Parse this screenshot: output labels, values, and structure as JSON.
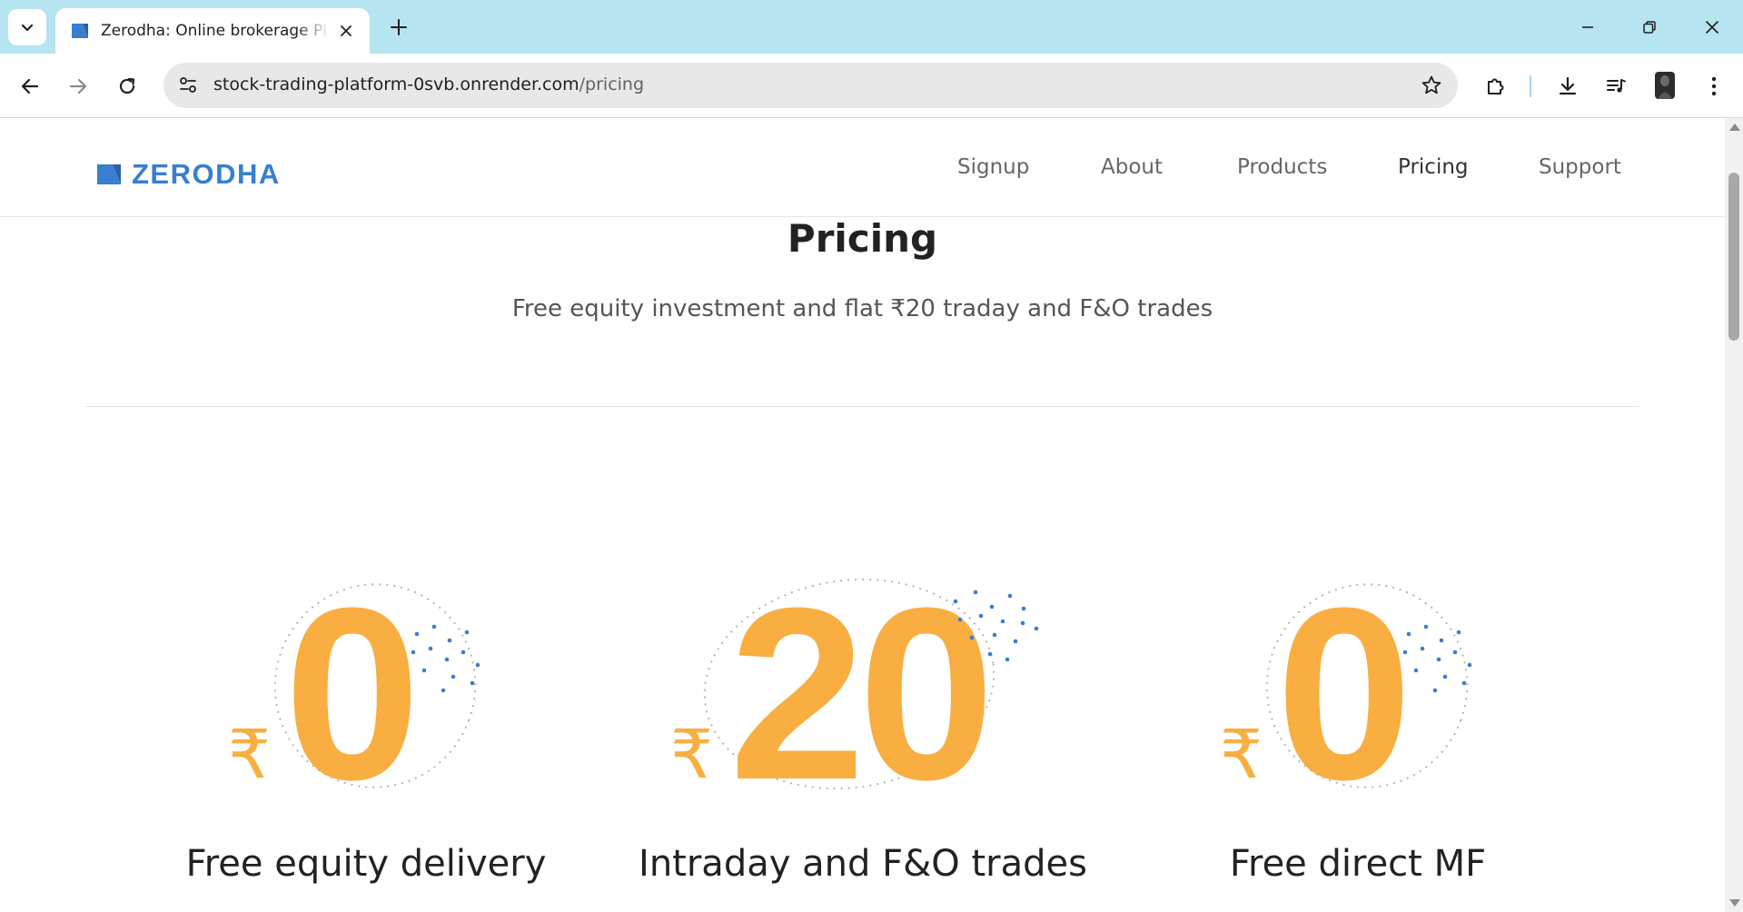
{
  "browser": {
    "tab_title": "Zerodha: Online brokerage Platform",
    "url_host": "stock-trading-platform-0svb.onrender.com",
    "url_path": "/pricing",
    "icons": {
      "tab_search": "chevron-down-icon",
      "tab_close": "close-icon",
      "new_tab": "plus-icon",
      "back": "arrow-left-icon",
      "forward": "arrow-right-icon",
      "reload": "reload-icon",
      "site_info": "tune-icon",
      "bookmark": "star-icon",
      "extensions": "puzzle-icon",
      "downloads": "download-icon",
      "media": "media-control-icon",
      "profile": "avatar",
      "menu": "kebab-menu-icon"
    }
  },
  "site": {
    "brand": "ZERODHA",
    "brand_color": "#387ed1",
    "nav": [
      {
        "label": "Signup"
      },
      {
        "label": "About"
      },
      {
        "label": "Products"
      },
      {
        "label": "Pricing",
        "active": true
      },
      {
        "label": "Support"
      }
    ]
  },
  "pricing": {
    "title": "Pricing",
    "subtitle": "Free equity investment and flat ₹20 traday and F&O trades",
    "accent_color": "#f9ae41",
    "currency_symbol": "₹",
    "cards": [
      {
        "amount": "0",
        "label": "Free equity delivery"
      },
      {
        "amount": "20",
        "label": "Intraday and F&O trades"
      },
      {
        "amount": "0",
        "label": "Free direct MF"
      }
    ]
  }
}
